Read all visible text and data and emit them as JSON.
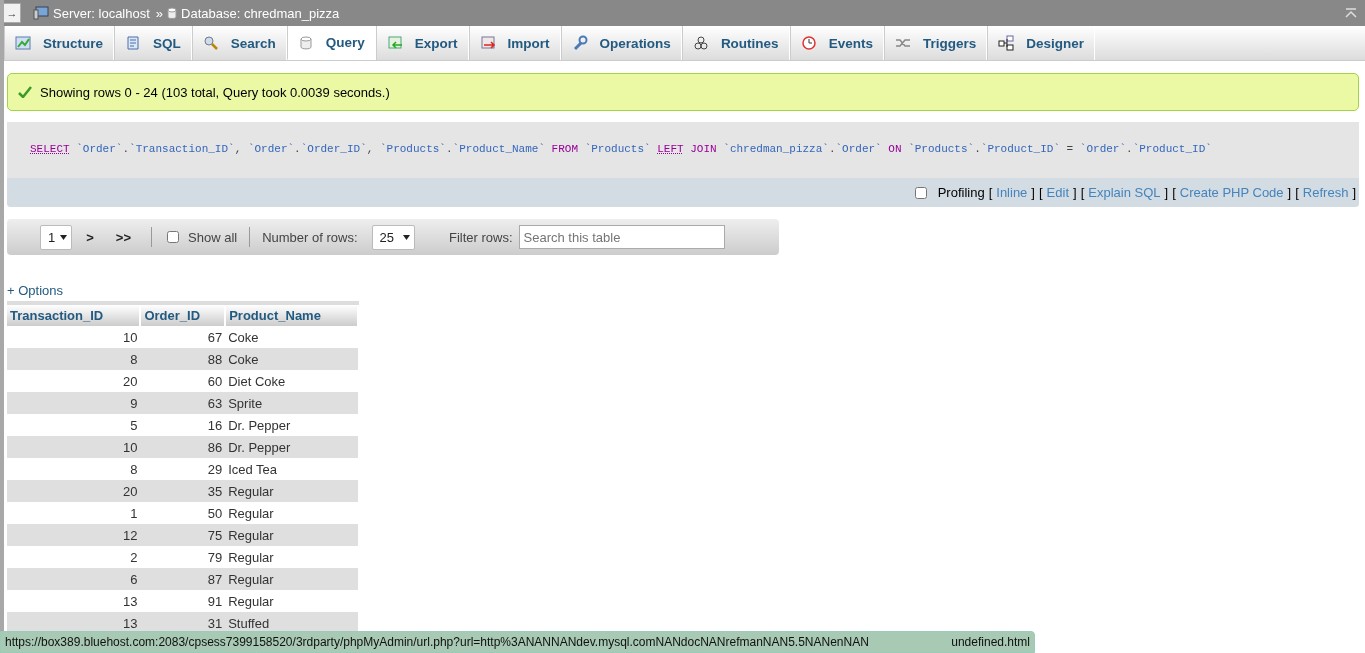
{
  "breadcrumb": {
    "back": "→",
    "server": "Server: localhost",
    "separator": "»",
    "database": "Database: chredman_pizza"
  },
  "tabs": [
    {
      "label": "Structure",
      "selected": false
    },
    {
      "label": "SQL",
      "selected": false
    },
    {
      "label": "Search",
      "selected": false
    },
    {
      "label": "Query",
      "selected": true
    },
    {
      "label": "Export",
      "selected": false
    },
    {
      "label": "Import",
      "selected": false
    },
    {
      "label": "Operations",
      "selected": false
    },
    {
      "label": "Routines",
      "selected": false
    },
    {
      "label": "Events",
      "selected": false
    },
    {
      "label": "Triggers",
      "selected": false
    },
    {
      "label": "Designer",
      "selected": false
    }
  ],
  "message": "Showing rows 0 - 24 (103 total, Query took 0.0039 seconds.)",
  "sql": [
    {
      "kind": "link",
      "text": "SELECT"
    },
    {
      "kind": "ident",
      "text": "`Order`"
    },
    {
      "kind": "plain",
      "text": "."
    },
    {
      "kind": "ident",
      "text": "`Transaction_ID`"
    },
    {
      "kind": "plain",
      "text": ","
    },
    {
      "kind": "ident",
      "text": "`Order`"
    },
    {
      "kind": "plain",
      "text": "."
    },
    {
      "kind": "ident",
      "text": "`Order_ID`"
    },
    {
      "kind": "plain",
      "text": ","
    },
    {
      "kind": "ident",
      "text": "`Products`"
    },
    {
      "kind": "plain",
      "text": "."
    },
    {
      "kind": "ident",
      "text": "`Product_Name`"
    },
    {
      "kind": "keyword",
      "text": "FROM"
    },
    {
      "kind": "ident",
      "text": "`Products`"
    },
    {
      "kind": "link",
      "text": "LEFT"
    },
    {
      "kind": "keyword",
      "text": "JOIN"
    },
    {
      "kind": "ident",
      "text": "`chredman_pizza`"
    },
    {
      "kind": "plain",
      "text": "."
    },
    {
      "kind": "ident",
      "text": "`Order`"
    },
    {
      "kind": "keyword",
      "text": "ON"
    },
    {
      "kind": "ident",
      "text": "`Products`"
    },
    {
      "kind": "plain",
      "text": "."
    },
    {
      "kind": "ident",
      "text": "`Product_ID`"
    },
    {
      "kind": "plain",
      "text": "="
    },
    {
      "kind": "ident",
      "text": "`Order`"
    },
    {
      "kind": "plain",
      "text": "."
    },
    {
      "kind": "ident",
      "text": "`Product_ID`"
    }
  ],
  "query_actions": {
    "profiling": {
      "label": "Profiling",
      "checked": false
    },
    "links": [
      {
        "open": "[",
        "label": "Inline",
        "close": "]"
      },
      {
        "open": "[",
        "label": "Edit",
        "close": "]"
      },
      {
        "open": "[",
        "label": "Explain SQL",
        "close": "]"
      },
      {
        "open": "[",
        "label": "Create PHP Code",
        "close": "]"
      },
      {
        "open": "[",
        "label": "Refresh",
        "close": "]"
      }
    ]
  },
  "navigation": {
    "page": "1",
    "next": ">",
    "last": ">>",
    "show_all": {
      "label": "Show all",
      "checked": false
    },
    "rows_label": "Number of rows:",
    "rows_value": "25",
    "filter_label": "Filter rows:",
    "filter": {
      "placeholder": "Search this table"
    }
  },
  "options": "+ Options",
  "table": {
    "columns": [
      "Transaction_ID",
      "Order_ID",
      "Product_Name"
    ],
    "rows": [
      [
        "10",
        "67",
        "Coke"
      ],
      [
        "8",
        "88",
        "Coke"
      ],
      [
        "20",
        "60",
        "Diet Coke"
      ],
      [
        "9",
        "63",
        "Sprite"
      ],
      [
        "5",
        "16",
        "Dr. Pepper"
      ],
      [
        "10",
        "86",
        "Dr. Pepper"
      ],
      [
        "8",
        "29",
        "Iced Tea"
      ],
      [
        "20",
        "35",
        "Regular"
      ],
      [
        "1",
        "50",
        "Regular"
      ],
      [
        "12",
        "75",
        "Regular"
      ],
      [
        "2",
        "79",
        "Regular"
      ],
      [
        "6",
        "87",
        "Regular"
      ],
      [
        "13",
        "91",
        "Regular"
      ],
      [
        "13",
        "31",
        "Stuffed"
      ]
    ]
  },
  "status_bar": {
    "url": "https://box389.bluehost.com:2083/cpsess7399158520/3rdparty/phpMyAdmin/url.php?url=http%3ANANNANdev.mysql.comNANdocNANrefmanNAN5.5NANenNAN",
    "tail": "undefined.html"
  }
}
